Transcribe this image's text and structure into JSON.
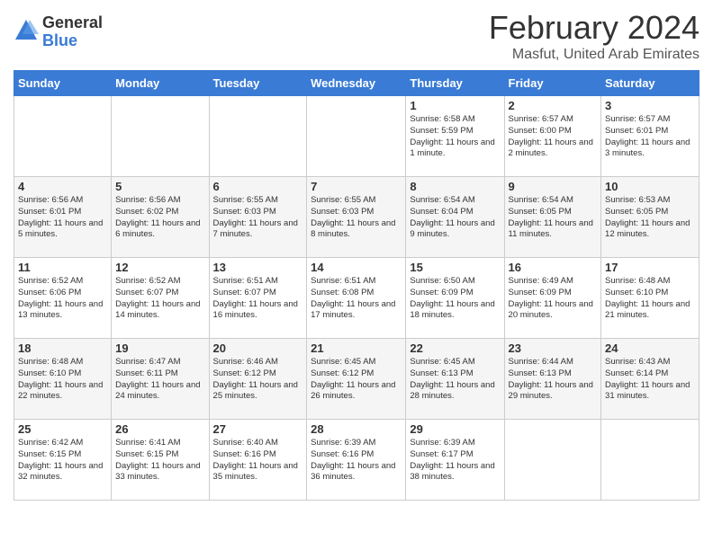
{
  "header": {
    "logo_general": "General",
    "logo_blue": "Blue",
    "main_title": "February 2024",
    "sub_title": "Masfut, United Arab Emirates"
  },
  "calendar": {
    "days_of_week": [
      "Sunday",
      "Monday",
      "Tuesday",
      "Wednesday",
      "Thursday",
      "Friday",
      "Saturday"
    ],
    "weeks": [
      [
        {
          "day": "",
          "info": ""
        },
        {
          "day": "",
          "info": ""
        },
        {
          "day": "",
          "info": ""
        },
        {
          "day": "",
          "info": ""
        },
        {
          "day": "1",
          "info": "Sunrise: 6:58 AM\nSunset: 5:59 PM\nDaylight: 11 hours and 1 minute."
        },
        {
          "day": "2",
          "info": "Sunrise: 6:57 AM\nSunset: 6:00 PM\nDaylight: 11 hours and 2 minutes."
        },
        {
          "day": "3",
          "info": "Sunrise: 6:57 AM\nSunset: 6:01 PM\nDaylight: 11 hours and 3 minutes."
        }
      ],
      [
        {
          "day": "4",
          "info": "Sunrise: 6:56 AM\nSunset: 6:01 PM\nDaylight: 11 hours and 5 minutes."
        },
        {
          "day": "5",
          "info": "Sunrise: 6:56 AM\nSunset: 6:02 PM\nDaylight: 11 hours and 6 minutes."
        },
        {
          "day": "6",
          "info": "Sunrise: 6:55 AM\nSunset: 6:03 PM\nDaylight: 11 hours and 7 minutes."
        },
        {
          "day": "7",
          "info": "Sunrise: 6:55 AM\nSunset: 6:03 PM\nDaylight: 11 hours and 8 minutes."
        },
        {
          "day": "8",
          "info": "Sunrise: 6:54 AM\nSunset: 6:04 PM\nDaylight: 11 hours and 9 minutes."
        },
        {
          "day": "9",
          "info": "Sunrise: 6:54 AM\nSunset: 6:05 PM\nDaylight: 11 hours and 11 minutes."
        },
        {
          "day": "10",
          "info": "Sunrise: 6:53 AM\nSunset: 6:05 PM\nDaylight: 11 hours and 12 minutes."
        }
      ],
      [
        {
          "day": "11",
          "info": "Sunrise: 6:52 AM\nSunset: 6:06 PM\nDaylight: 11 hours and 13 minutes."
        },
        {
          "day": "12",
          "info": "Sunrise: 6:52 AM\nSunset: 6:07 PM\nDaylight: 11 hours and 14 minutes."
        },
        {
          "day": "13",
          "info": "Sunrise: 6:51 AM\nSunset: 6:07 PM\nDaylight: 11 hours and 16 minutes."
        },
        {
          "day": "14",
          "info": "Sunrise: 6:51 AM\nSunset: 6:08 PM\nDaylight: 11 hours and 17 minutes."
        },
        {
          "day": "15",
          "info": "Sunrise: 6:50 AM\nSunset: 6:09 PM\nDaylight: 11 hours and 18 minutes."
        },
        {
          "day": "16",
          "info": "Sunrise: 6:49 AM\nSunset: 6:09 PM\nDaylight: 11 hours and 20 minutes."
        },
        {
          "day": "17",
          "info": "Sunrise: 6:48 AM\nSunset: 6:10 PM\nDaylight: 11 hours and 21 minutes."
        }
      ],
      [
        {
          "day": "18",
          "info": "Sunrise: 6:48 AM\nSunset: 6:10 PM\nDaylight: 11 hours and 22 minutes."
        },
        {
          "day": "19",
          "info": "Sunrise: 6:47 AM\nSunset: 6:11 PM\nDaylight: 11 hours and 24 minutes."
        },
        {
          "day": "20",
          "info": "Sunrise: 6:46 AM\nSunset: 6:12 PM\nDaylight: 11 hours and 25 minutes."
        },
        {
          "day": "21",
          "info": "Sunrise: 6:45 AM\nSunset: 6:12 PM\nDaylight: 11 hours and 26 minutes."
        },
        {
          "day": "22",
          "info": "Sunrise: 6:45 AM\nSunset: 6:13 PM\nDaylight: 11 hours and 28 minutes."
        },
        {
          "day": "23",
          "info": "Sunrise: 6:44 AM\nSunset: 6:13 PM\nDaylight: 11 hours and 29 minutes."
        },
        {
          "day": "24",
          "info": "Sunrise: 6:43 AM\nSunset: 6:14 PM\nDaylight: 11 hours and 31 minutes."
        }
      ],
      [
        {
          "day": "25",
          "info": "Sunrise: 6:42 AM\nSunset: 6:15 PM\nDaylight: 11 hours and 32 minutes."
        },
        {
          "day": "26",
          "info": "Sunrise: 6:41 AM\nSunset: 6:15 PM\nDaylight: 11 hours and 33 minutes."
        },
        {
          "day": "27",
          "info": "Sunrise: 6:40 AM\nSunset: 6:16 PM\nDaylight: 11 hours and 35 minutes."
        },
        {
          "day": "28",
          "info": "Sunrise: 6:39 AM\nSunset: 6:16 PM\nDaylight: 11 hours and 36 minutes."
        },
        {
          "day": "29",
          "info": "Sunrise: 6:39 AM\nSunset: 6:17 PM\nDaylight: 11 hours and 38 minutes."
        },
        {
          "day": "",
          "info": ""
        },
        {
          "day": "",
          "info": ""
        }
      ]
    ]
  }
}
